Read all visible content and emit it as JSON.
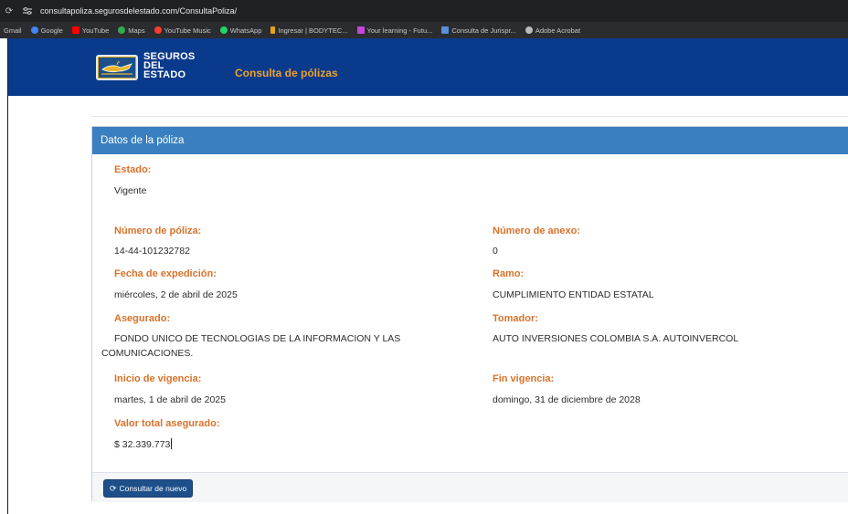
{
  "browser": {
    "url": "consultapoliza.segurosdelestado.com/ConsultaPoliza/",
    "bookmarks": [
      {
        "label": "Gmail",
        "color": ""
      },
      {
        "label": "Google",
        "color": "#4285f4"
      },
      {
        "label": "YouTube",
        "color": "#ff0000"
      },
      {
        "label": "Maps",
        "color": "#34a853"
      },
      {
        "label": "YouTube Music",
        "color": "#ff3b30"
      },
      {
        "label": "WhatsApp",
        "color": "#25d366"
      },
      {
        "label": "Ingresar | BODYTEC...",
        "color": "#e6a21d"
      },
      {
        "label": "Your learning - Futu...",
        "color": "#c546d9"
      },
      {
        "label": "Consulta de Jurispr...",
        "color": "#5b8fd6"
      },
      {
        "label": "Adobe Acrobat",
        "color": "#bbbbbb"
      }
    ]
  },
  "header": {
    "logo_line1": "SEGUROS",
    "logo_line2": "DEL",
    "logo_line3": "ESTADO",
    "title": "Consulta de pólizas"
  },
  "card": {
    "title": "Datos de la póliza",
    "estado_label": "Estado:",
    "estado_value": "Vigente",
    "numero_poliza_label": "Número de póliza:",
    "numero_poliza_value": "14-44-101232782",
    "numero_anexo_label": "Número de anexo:",
    "numero_anexo_value": "0",
    "fecha_expedicion_label": "Fecha de expedición:",
    "fecha_expedicion_value": "miércoles, 2 de abril de 2025",
    "ramo_label": "Ramo:",
    "ramo_value": "CUMPLIMIENTO ENTIDAD ESTATAL",
    "asegurado_label": "Asegurado:",
    "asegurado_value_line1": "FONDO UNICO DE TECNOLOGIAS DE LA INFORMACION Y LAS",
    "asegurado_value_line2": "COMUNICACIONES.",
    "tomador_label": "Tomador:",
    "tomador_value": "AUTO INVERSIONES COLOMBIA S.A. AUTOINVERCOL",
    "inicio_label": "Inicio de vigencia:",
    "inicio_value": "martes, 1 de abril de 2025",
    "fin_label": "Fin vigencia:",
    "fin_value": "domingo, 31 de diciembre de 2028",
    "valor_label": "Valor total asegurado:",
    "valor_value": "$ 32.339.773",
    "button_label": "Consultar de nuevo"
  },
  "colors": {
    "header_bg": "#0a3a8c",
    "card_header_bg": "#3a7fc0",
    "label_color": "#d9722a",
    "button_bg": "#1d4f8a"
  }
}
